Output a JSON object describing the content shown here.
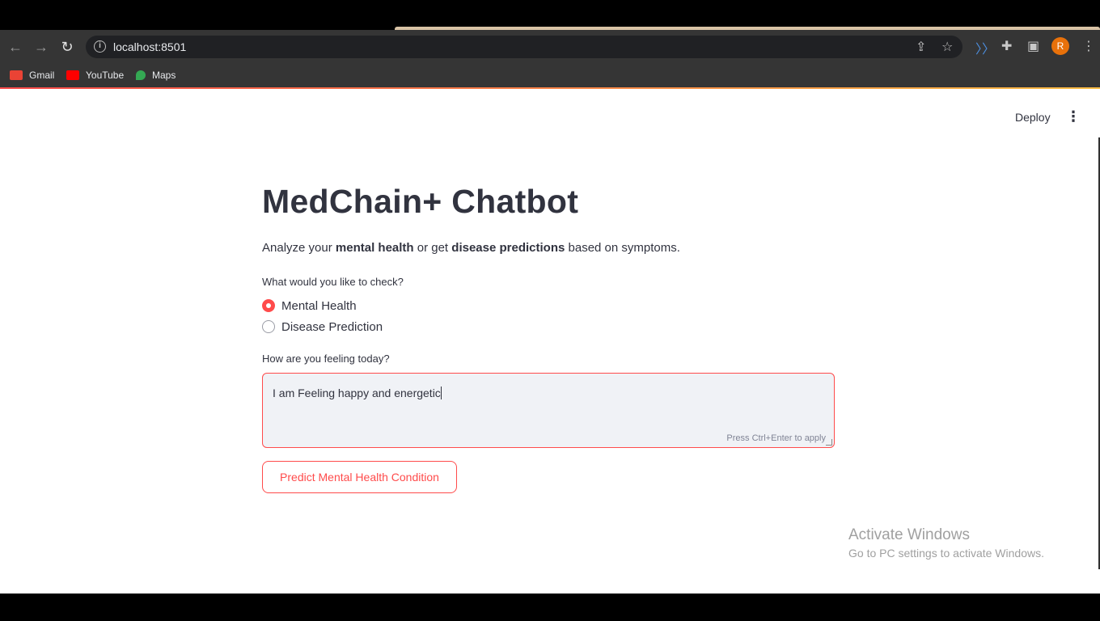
{
  "browser": {
    "url": "localhost:8501",
    "profile_initial": "R",
    "bookmarks": [
      {
        "label": "Gmail",
        "icon": "gmail-icon",
        "color": "#ea4335"
      },
      {
        "label": "YouTube",
        "icon": "youtube-icon",
        "color": "#ff0000"
      },
      {
        "label": "Maps",
        "icon": "maps-icon",
        "color": "#34a853"
      }
    ]
  },
  "app": {
    "deploy_label": "Deploy",
    "title": "MedChain+ Chatbot",
    "subtitle": {
      "part1": "Analyze your ",
      "bold1": "mental health",
      "part2": " or get ",
      "bold2": "disease predictions",
      "part3": " based on symptoms."
    },
    "check_label": "What would you like to check?",
    "options": [
      "Mental Health",
      "Disease Prediction"
    ],
    "selected_option": "Mental Health",
    "feeling_label": "How are you feeling today?",
    "feeling_value": "I am Feeling happy and energetic",
    "textarea_hint": "Press Ctrl+Enter to apply",
    "predict_button": "Predict Mental Health Condition",
    "accent_color": "#ff4b4b"
  },
  "overlay": {
    "activate_title": "Activate Windows",
    "activate_sub": "Go to PC settings to activate Windows."
  }
}
